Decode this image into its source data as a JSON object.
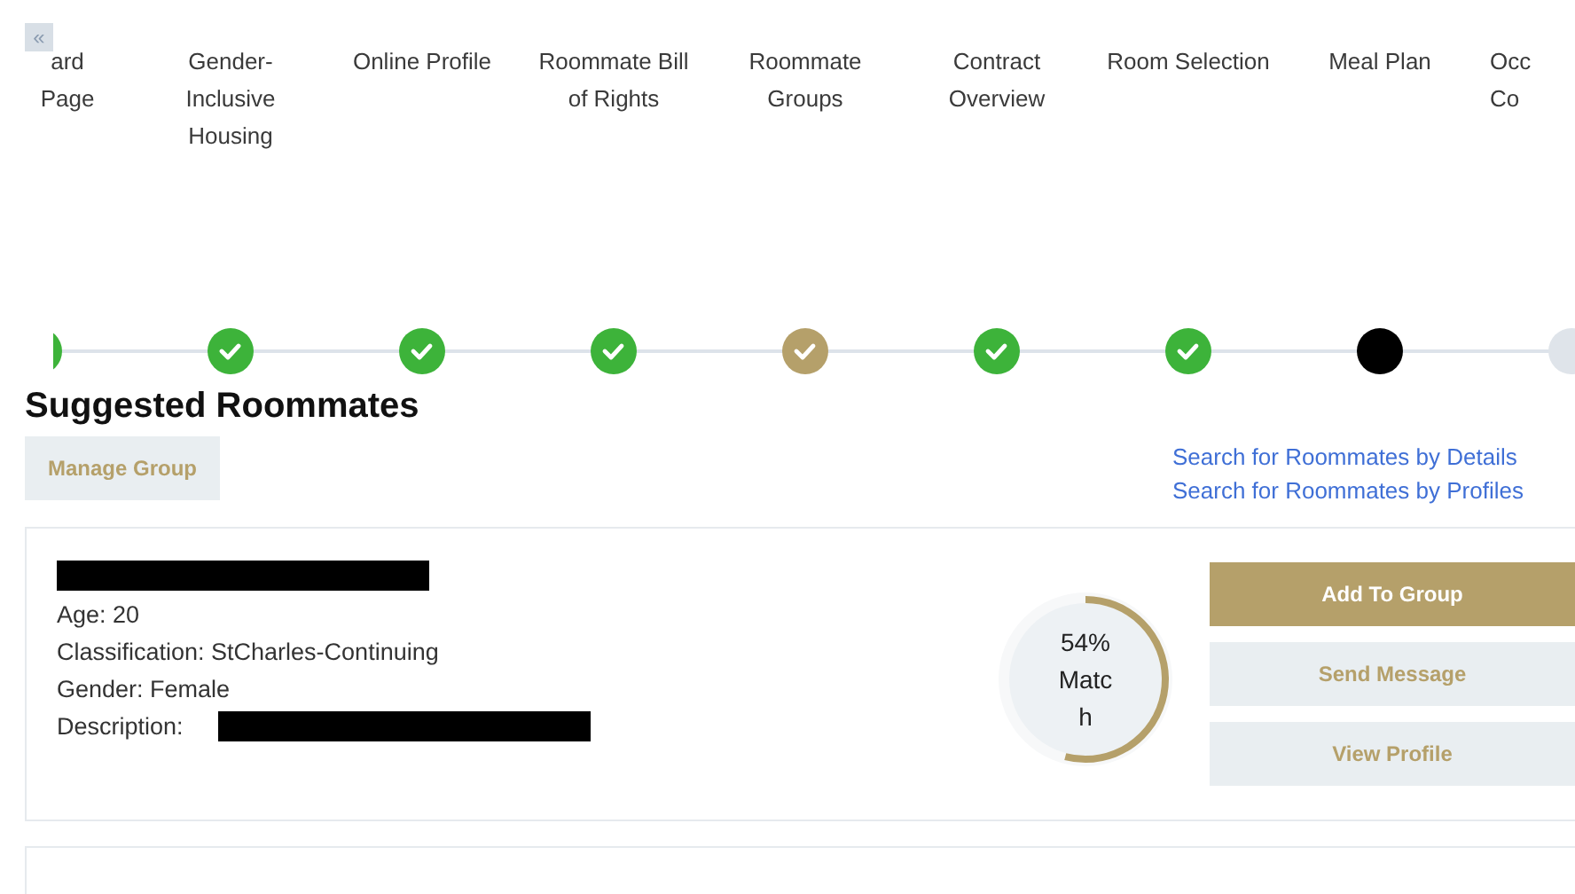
{
  "nav": {
    "prev": "«"
  },
  "tabs": [
    {
      "label": "ard Page"
    },
    {
      "label": "Gender-Inclusive Housing"
    },
    {
      "label": "Online Profile"
    },
    {
      "label": "Roommate Bill of Rights"
    },
    {
      "label": "Roommate Groups"
    },
    {
      "label": "Contract Overview"
    },
    {
      "label": "Room Selection"
    },
    {
      "label": "Meal Plan"
    },
    {
      "label": "Occ Co"
    }
  ],
  "steps": [
    {
      "kind": "complete"
    },
    {
      "kind": "complete"
    },
    {
      "kind": "complete"
    },
    {
      "kind": "complete"
    },
    {
      "kind": "attention"
    },
    {
      "kind": "complete"
    },
    {
      "kind": "complete"
    },
    {
      "kind": "current"
    },
    {
      "kind": "upcoming"
    }
  ],
  "heading": "Suggested Roommates",
  "manage_button": "Manage Group",
  "search_links": [
    "Search for Roommates by Details",
    "Search for Roommates by Profiles"
  ],
  "roommates": [
    {
      "details": [
        "Age: 20",
        "Classification: StCharles-Continuing",
        "Gender: Female",
        "Description:"
      ],
      "match": {
        "percent": "54%",
        "label": "Match",
        "level": 0.54
      },
      "actions": [
        {
          "label": "Add To Group",
          "kind": "primary"
        },
        {
          "label": "Send Message",
          "kind": "secondary"
        },
        {
          "label": "View Profile",
          "kind": "secondary"
        }
      ]
    }
  ]
}
